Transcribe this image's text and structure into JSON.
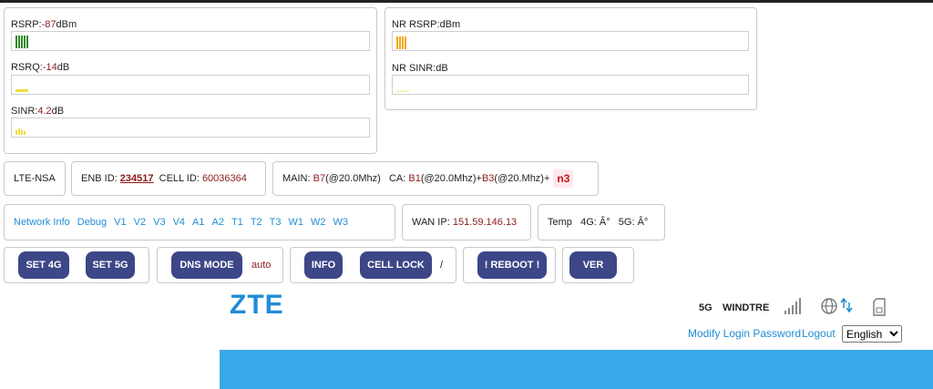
{
  "lte_panel": {
    "rsrp_label": "RSRP:",
    "rsrp_value": "-87",
    "rsrp_unit": "dBm",
    "rsrq_label": "RSRQ:",
    "rsrq_value": "-14",
    "rsrq_unit": "dB",
    "sinr_label": "SINR:",
    "sinr_value": "4.2",
    "sinr_unit": "dB",
    "colors": {
      "rsrp": "#2e8b22",
      "rsrq": "#f0e040",
      "sinr": "#f0e040"
    }
  },
  "nr_panel": {
    "rsrp_label": "NR RSRP:",
    "rsrp_value": "",
    "rsrp_unit": "dBm",
    "sinr_label": "NR SINR:",
    "sinr_value": "",
    "sinr_unit": "dB",
    "colors": {
      "rsrp": "#f0a818",
      "sinr": "#f5f0c0"
    }
  },
  "status_row": {
    "mode": "LTE-NSA",
    "enb_label": "ENB ID:",
    "enb_value": "234517",
    "cell_label": "CELL ID:",
    "cell_value": "60036364",
    "main_label": "MAIN:",
    "main_band": "B7",
    "main_bw": "(@20.0Mhz)",
    "ca_label": "CA:",
    "ca_band1": "B1",
    "ca_bw1": "(@20.0Mhz)+",
    "ca_band2": "B3",
    "ca_bw2": "(@20.Mhz)+",
    "nr_band": "n3"
  },
  "nav_row": {
    "links": [
      "Network Info",
      "Debug",
      "V1",
      "V2",
      "V3",
      "V4",
      "A1",
      "A2",
      "T1",
      "T2",
      "T3",
      "W1",
      "W2",
      "W3"
    ],
    "wan_label": "WAN IP:",
    "wan_value": "151.59.146.13",
    "temp_label": "Temp",
    "temp_4g": "4G: Â°",
    "temp_5g": "5G: Â°"
  },
  "buttons": {
    "set4g": "SET 4G",
    "set5g": "SET 5G",
    "dns_mode": "DNS MODE",
    "dns_value": "auto",
    "info": "INFO",
    "cell_lock": "CELL LOCK",
    "cell_lock_value": "/",
    "reboot": "! REBOOT !",
    "ver": "VER"
  },
  "zte_header": {
    "logo": "ZTE",
    "network_type": "5G",
    "operator": "WINDTRE",
    "modify_password": "Modify Login Password",
    "logout": "Logout",
    "language_selected": "English",
    "colors": {
      "logo": "#1f8dd6",
      "banner": "#3aa8e8",
      "link": "#1f8dd6"
    },
    "icons": [
      "signal-icon",
      "globe-icon",
      "sim-icon"
    ]
  }
}
